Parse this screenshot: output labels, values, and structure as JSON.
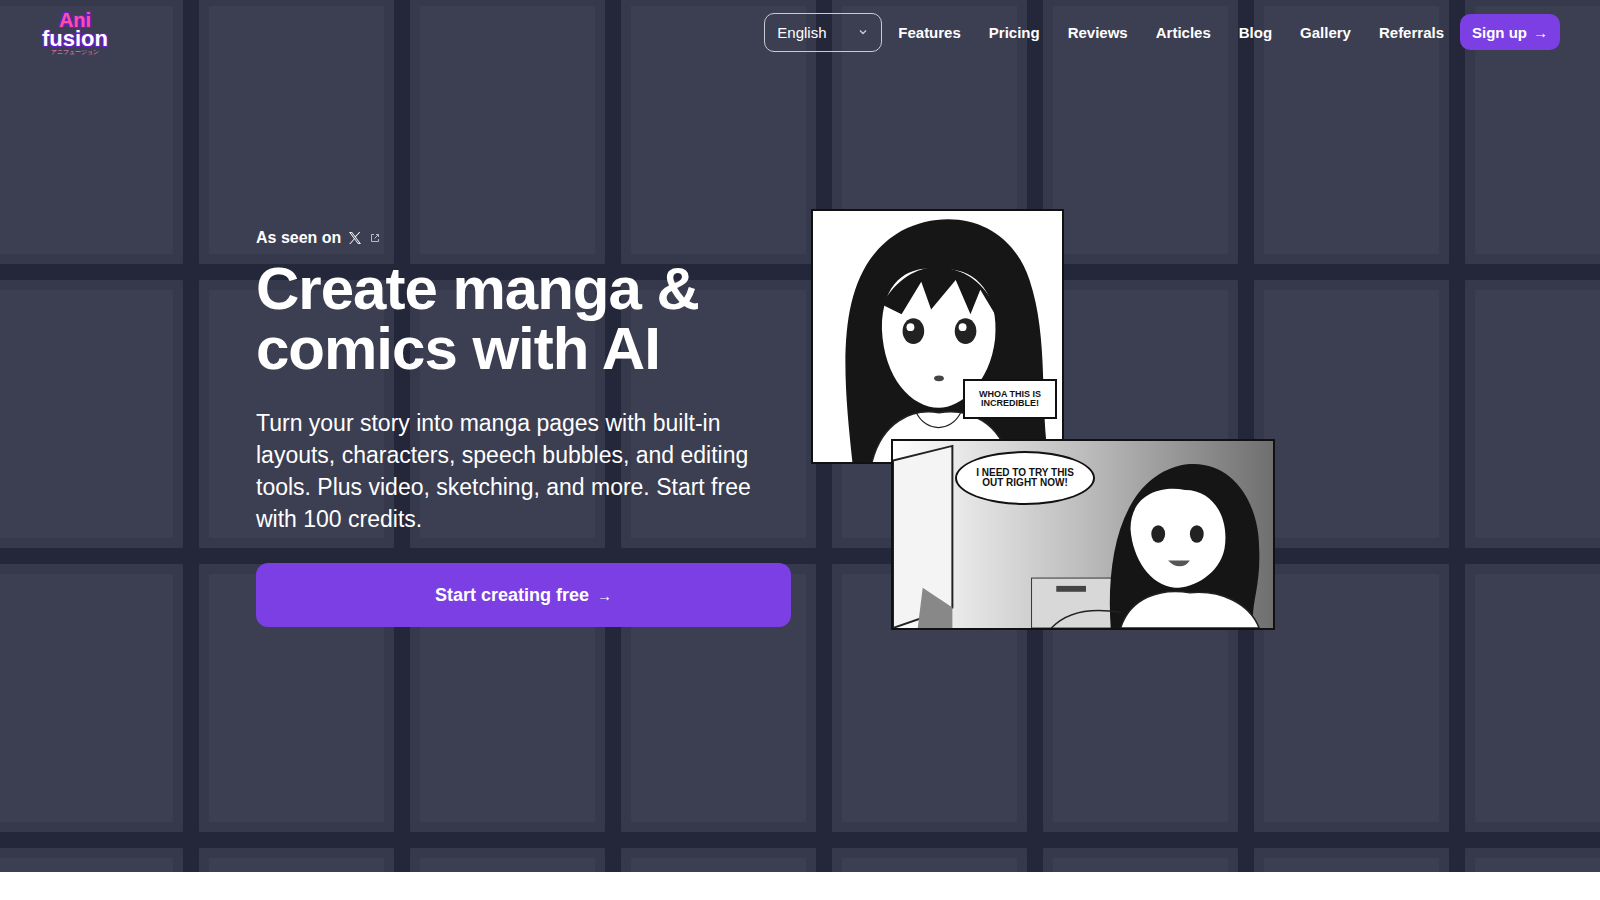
{
  "logo": {
    "lines": [
      "Ani",
      "fusion"
    ],
    "subtitle": "アニフュージョン"
  },
  "language": {
    "value": "English"
  },
  "nav": [
    {
      "label": "Features"
    },
    {
      "label": "Pricing"
    },
    {
      "label": "Reviews"
    },
    {
      "label": "Articles"
    },
    {
      "label": "Blog"
    },
    {
      "label": "Gallery"
    },
    {
      "label": "Referrals"
    }
  ],
  "signup": {
    "label": "Sign up",
    "arrow": "→"
  },
  "hero": {
    "seen_on": "As seen on",
    "title": "Create manga & comics with AI",
    "subtitle": "Turn your story into manga pages with built-in layouts, characters, speech bubbles, and editing tools. Plus video, sketching, and more. Start free with 100 credits.",
    "cta": {
      "label": "Start creating free",
      "arrow": "→"
    }
  },
  "panels": [
    {
      "bubble": "WHOA THIS IS INCREDIBLE!"
    },
    {
      "bubble": "I NEED TO TRY THIS OUT RIGHT NOW!"
    }
  ]
}
